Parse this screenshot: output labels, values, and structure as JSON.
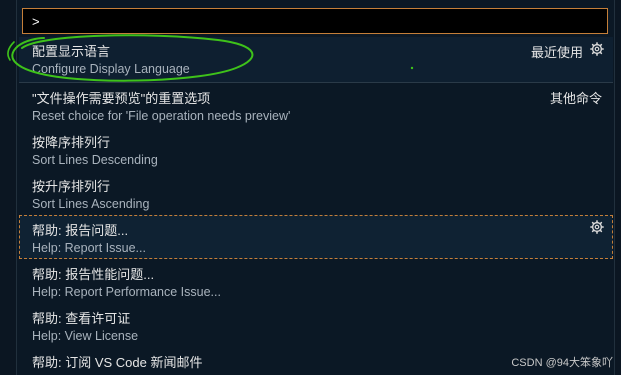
{
  "quick_open": {
    "input_value": ">"
  },
  "items": [
    {
      "title": "配置显示语言",
      "subtitle": "Configure Display Language",
      "tag": "最近使用",
      "gear": true
    },
    {
      "title": "\"文件操作需要预览\"的重置选项",
      "subtitle": "Reset choice for 'File operation needs preview'",
      "tag": "其他命令",
      "gear": false
    },
    {
      "title": "按降序排列行",
      "subtitle": "Sort Lines Descending",
      "tag": "",
      "gear": false
    },
    {
      "title": "按升序排列行",
      "subtitle": "Sort Lines Ascending",
      "tag": "",
      "gear": false
    },
    {
      "title": "帮助: 报告问题...",
      "subtitle": "Help: Report Issue...",
      "tag": "",
      "gear": true
    },
    {
      "title": "帮助: 报告性能问题...",
      "subtitle": "Help: Report Performance Issue...",
      "tag": "",
      "gear": false
    },
    {
      "title": "帮助: 查看许可证",
      "subtitle": "Help: View License",
      "tag": "",
      "gear": false
    },
    {
      "title": "帮助: 订阅 VS Code 新闻邮件",
      "subtitle": "",
      "tag": "",
      "gear": false
    }
  ],
  "watermark": "CSDN @94大笨象吖",
  "colors": {
    "focus_border": "#c57f39",
    "annotation": "#3ec21a"
  }
}
